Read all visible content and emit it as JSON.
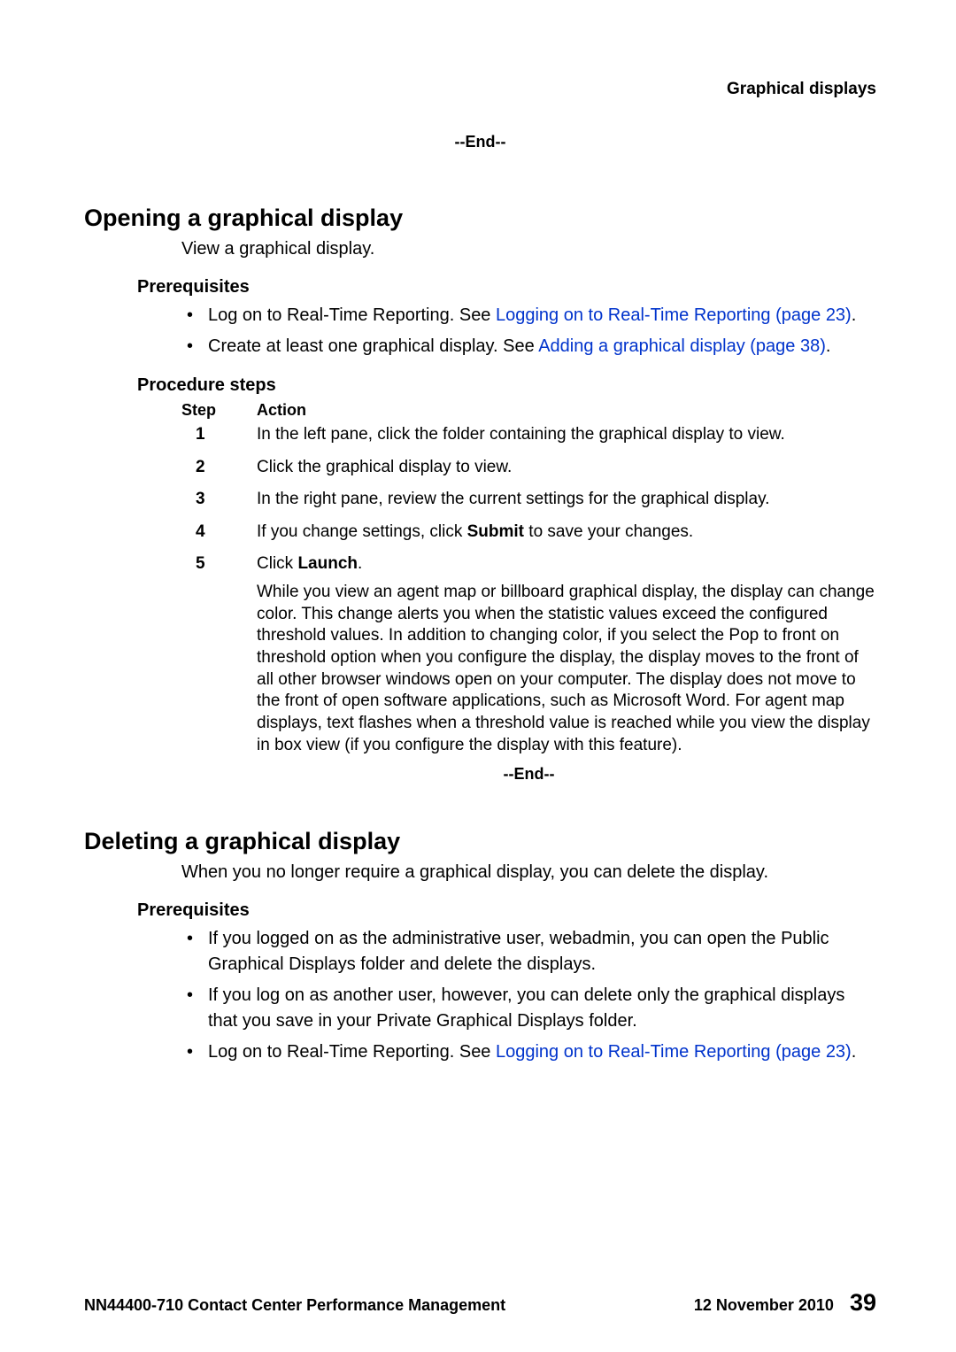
{
  "header": {
    "right": "Graphical displays"
  },
  "end_marker": "--End--",
  "section1": {
    "title": "Opening a graphical display",
    "intro": "View a graphical display.",
    "prereq_title": "Prerequisites",
    "prereqs": [
      {
        "text": "Log on to Real-Time Reporting. See ",
        "link": "Logging on to Real-Time Reporting (page 23)",
        "tail": "."
      },
      {
        "text": "Create at least one graphical display. See ",
        "link": "Adding a graphical display (page 38)",
        "tail": "."
      }
    ],
    "procedure_title": "Procedure steps",
    "head_step": "Step",
    "head_action": "Action",
    "steps": [
      {
        "text": "In the left pane, click the folder containing the graphical display to view."
      },
      {
        "text": "Click the graphical display to view."
      },
      {
        "text": "In the right pane, review the current settings for the graphical display."
      },
      {
        "text_a": "If you change settings, click ",
        "bold": "Submit",
        "text_b": " to save your changes."
      },
      {
        "text_a": "Click ",
        "bold": "Launch",
        "text_b": ".",
        "para": "While you view an agent map or billboard graphical display, the display can change color. This change alerts you when the statistic values exceed the configured threshold values. In addition to changing color, if you select the Pop to front on threshold option when you configure the display, the display moves to the front of all other browser windows open on your computer. The display does not move to the front of open software applications, such as Microsoft Word. For agent map displays, text flashes when a threshold value is reached while you view the display in box view (if you configure the display with this feature)."
      }
    ]
  },
  "section2": {
    "title": "Deleting a graphical display",
    "intro": "When you no longer require a graphical display, you can delete the display.",
    "prereq_title": "Prerequisites",
    "prereqs": [
      {
        "text": "If you logged on as the administrative user, webadmin, you can open the Public Graphical Displays folder and delete the displays."
      },
      {
        "text": "If you log on as another user, however, you can delete only the graphical displays that you save in your Private Graphical Displays folder."
      },
      {
        "text": "Log on to Real-Time Reporting. See ",
        "link": "Logging on to Real-Time Reporting (page 23)",
        "tail": "."
      }
    ]
  },
  "footer": {
    "doc": "NN44400-710 Contact Center Performance Management",
    "date": "12 November 2010",
    "page": "39"
  }
}
